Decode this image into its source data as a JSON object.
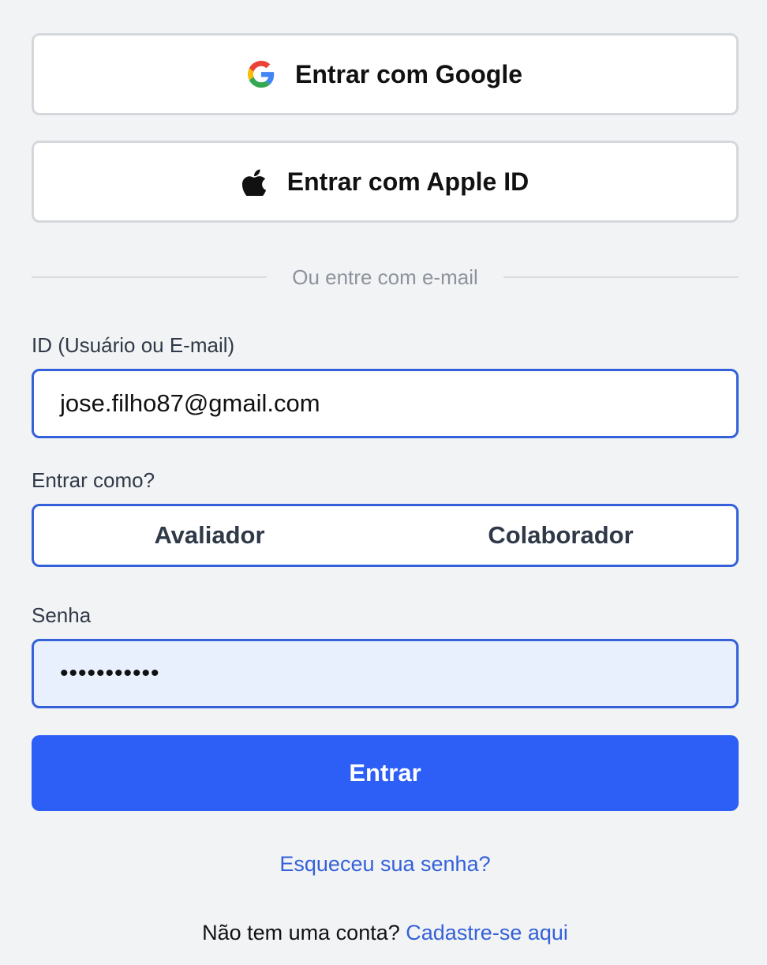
{
  "social": {
    "google_label": "Entrar com Google",
    "apple_label": "Entrar com Apple ID"
  },
  "divider": {
    "text": "Ou entre com e-mail"
  },
  "form": {
    "id_label": "ID (Usuário ou E-mail)",
    "id_value": "jose.filho87@gmail.com",
    "role_label": "Entrar como?",
    "role_options": [
      "Avaliador",
      "Colaborador"
    ],
    "password_label": "Senha",
    "password_value": "•••••••••••",
    "submit_label": "Entrar"
  },
  "links": {
    "forgot_password": "Esqueceu sua senha?",
    "signup_prompt": "Não tem uma conta?",
    "signup_link": "Cadastre-se aqui"
  },
  "icons": {
    "google": "google-logo-icon",
    "apple": "apple-logo-icon"
  },
  "colors": {
    "background": "#f2f3f5",
    "accent": "#3461d9",
    "primary_button": "#2d5ef5",
    "password_fill": "#e8f0fe"
  }
}
